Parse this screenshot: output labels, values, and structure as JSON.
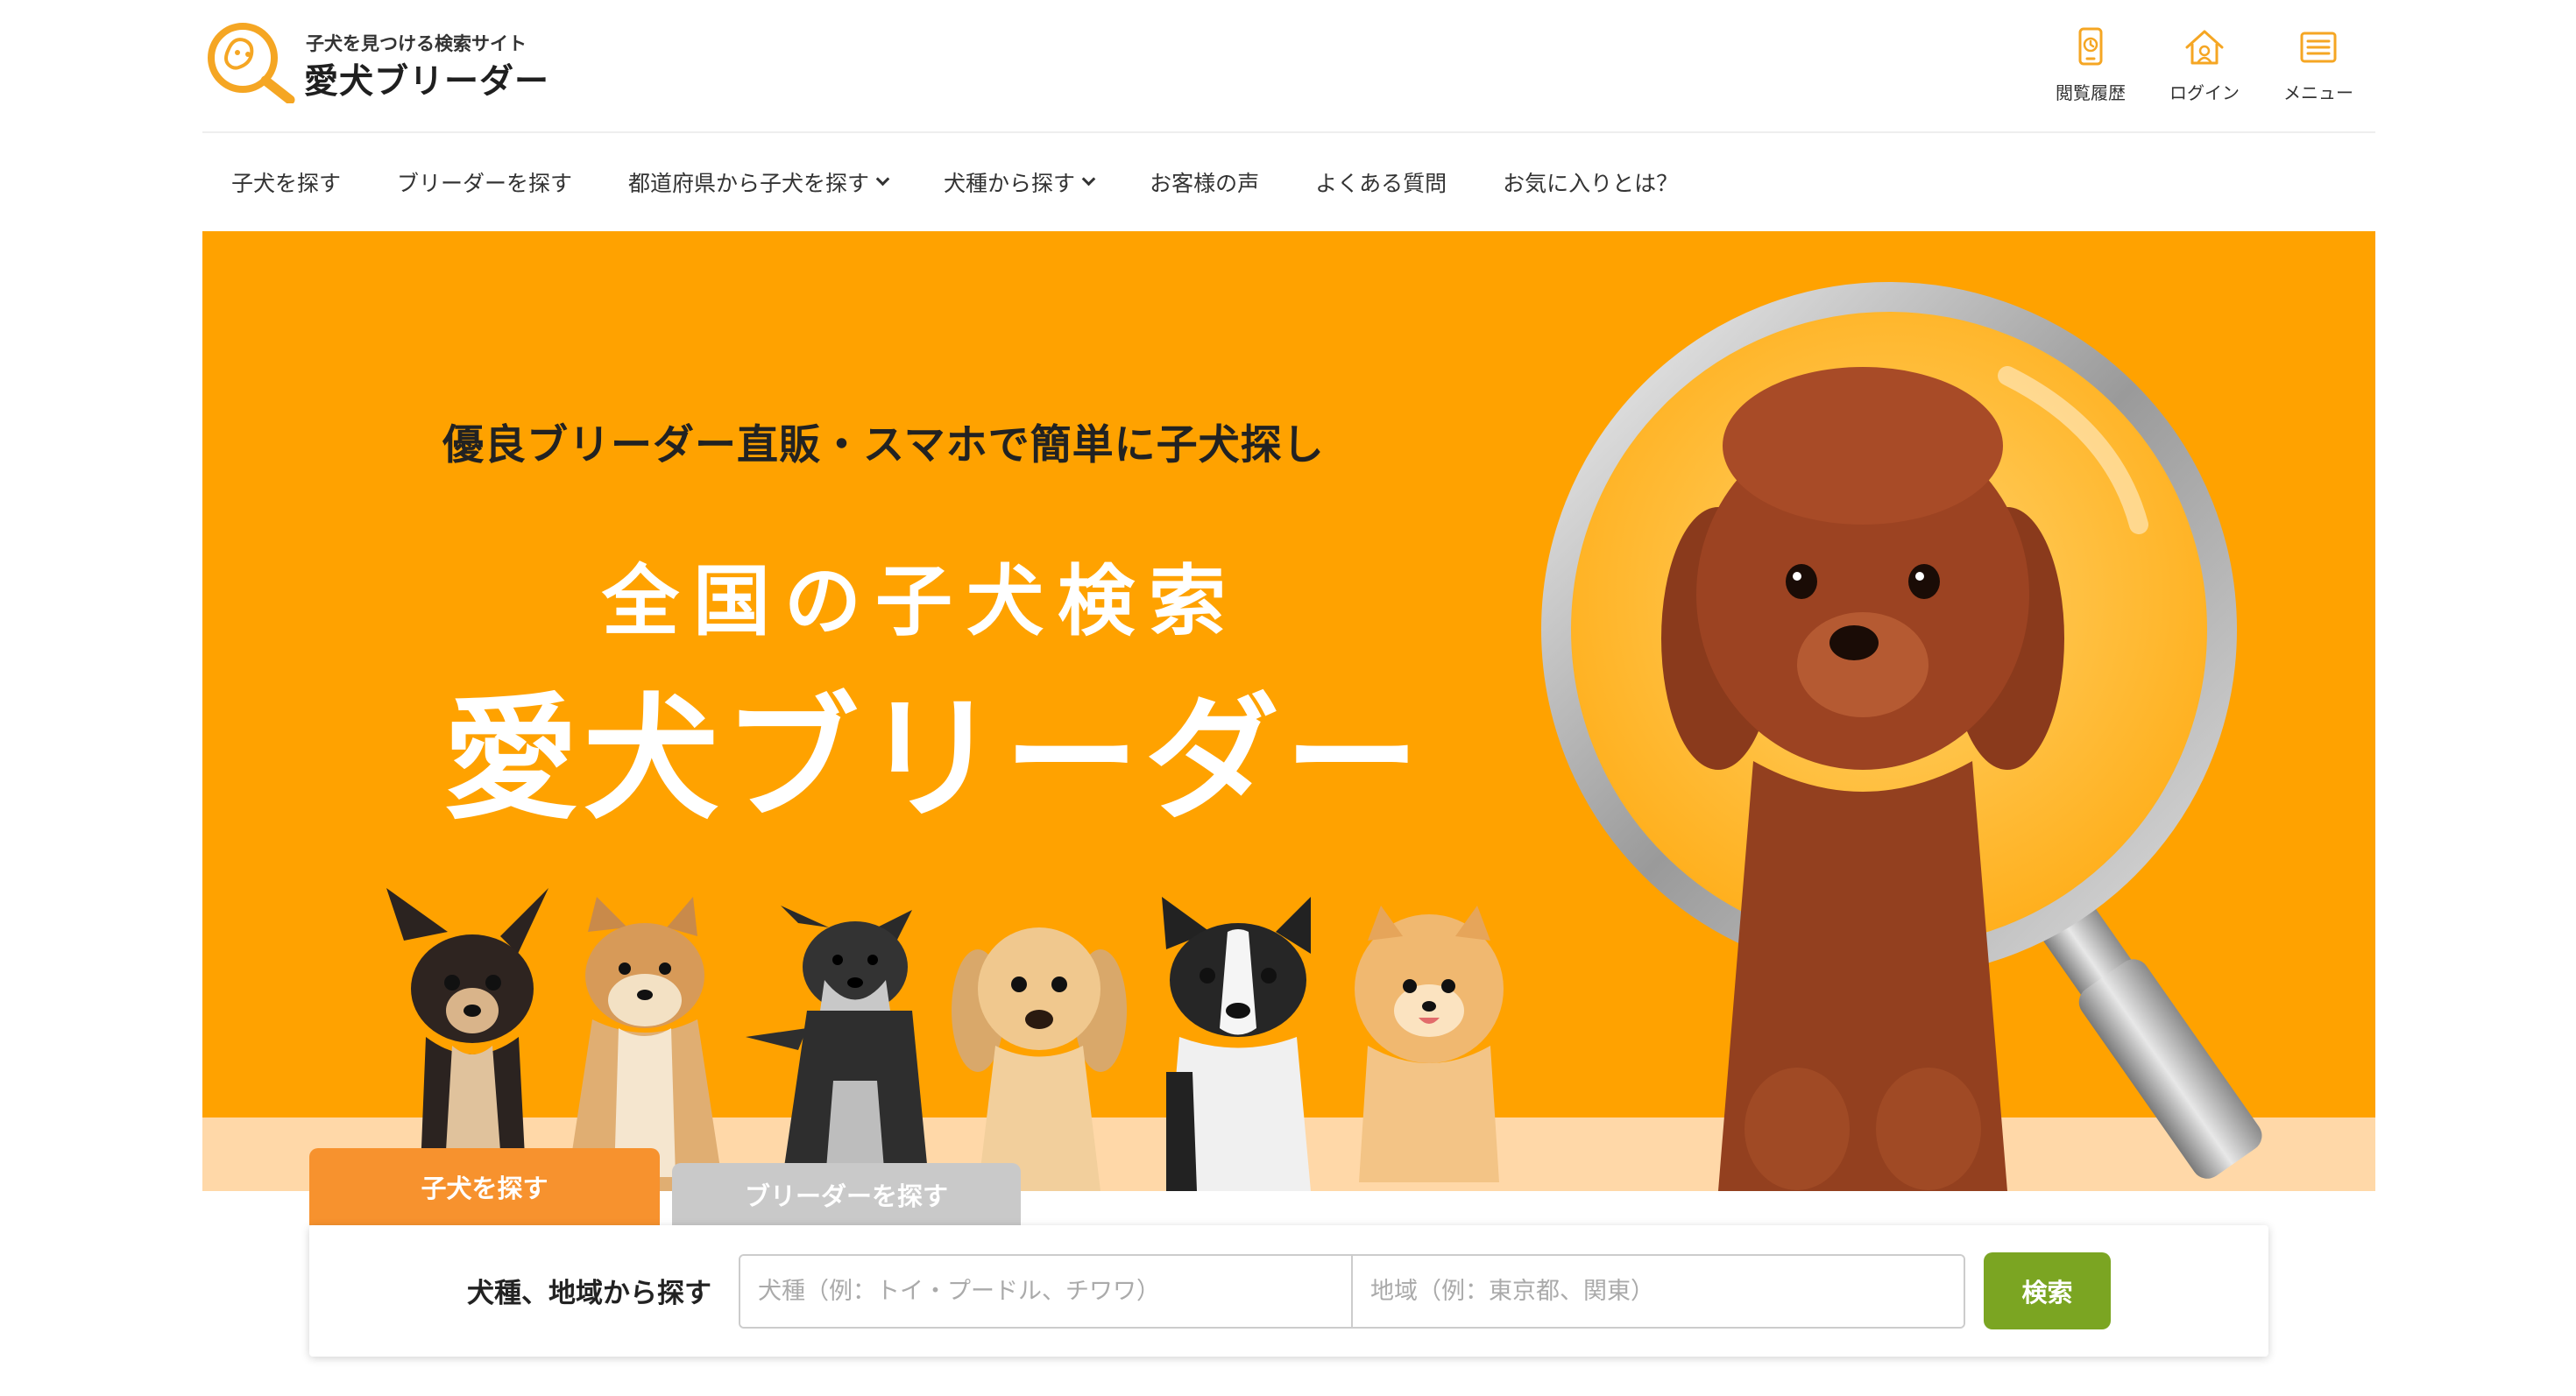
{
  "header": {
    "logo_tagline": "子犬を見つける検索サイト",
    "logo_name": "愛犬ブリーダー",
    "nav": [
      {
        "label": "閲覧履歴",
        "icon": "phone-history-icon"
      },
      {
        "label": "ログイン",
        "icon": "house-icon"
      },
      {
        "label": "メニュー",
        "icon": "menu-list-icon"
      }
    ]
  },
  "global_nav": [
    {
      "label": "子犬を探す",
      "has_dropdown": false
    },
    {
      "label": "ブリーダーを探す",
      "has_dropdown": false
    },
    {
      "label": "都道府県から子犬を探す",
      "has_dropdown": true
    },
    {
      "label": "犬種から探す",
      "has_dropdown": true
    },
    {
      "label": "お客様の声",
      "has_dropdown": false
    },
    {
      "label": "よくある質問",
      "has_dropdown": false
    },
    {
      "label": "お気に入りとは？",
      "has_dropdown": false
    }
  ],
  "hero": {
    "subtitle": "優良ブリーダー直販・スマホで簡単に子犬探し",
    "title_line1": "全国の子犬検索",
    "title_line2": "愛犬ブリーダー"
  },
  "search": {
    "tabs": [
      {
        "label": "子犬を探す",
        "active": true
      },
      {
        "label": "ブリーダーを探す",
        "active": false
      }
    ],
    "label": "犬種、地域から探す",
    "breed_placeholder": "犬種（例：トイ・プードル、チワワ）",
    "area_placeholder": "地域（例：東京都、関東）",
    "button_label": "検索"
  },
  "colors": {
    "brand_orange": "#ffa200",
    "tab_active": "#f7922e",
    "tab_inactive": "#c9c9c9",
    "search_button": "#7ba522",
    "icon_accent": "#f5a623"
  }
}
